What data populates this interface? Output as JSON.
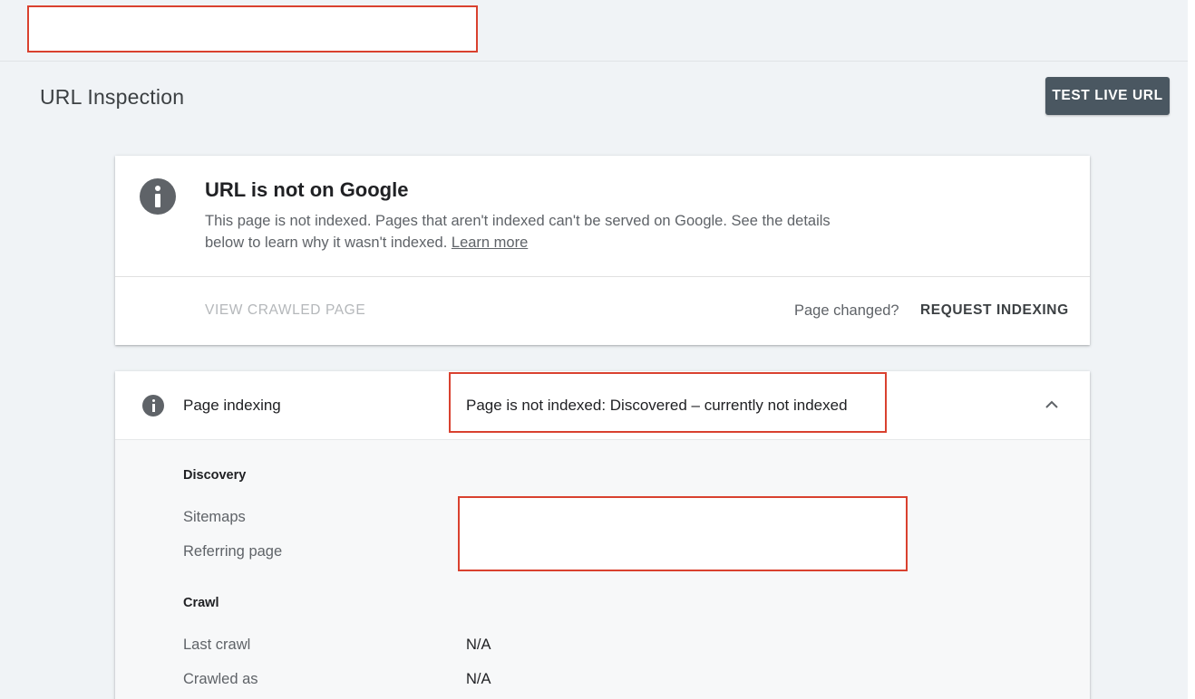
{
  "header": {
    "title": "URL Inspection",
    "test_live_url_label": "TEST LIVE URL"
  },
  "status_card": {
    "title": "URL is not on Google",
    "description": "This page is not indexed. Pages that aren't indexed can't be served on Google. See the details below to learn why it wasn't indexed.",
    "learn_more_label": "Learn more",
    "view_crawled_label": "VIEW CRAWLED PAGE",
    "page_changed_label": "Page changed?",
    "request_indexing_label": "REQUEST INDEXING",
    "icon": "info-icon"
  },
  "indexing_card": {
    "label": "Page indexing",
    "status": "Page is not indexed: Discovered – currently not indexed",
    "icon": "info-icon",
    "expanded": true,
    "sections": {
      "discovery": {
        "title": "Discovery",
        "rows": [
          {
            "label": "Sitemaps",
            "value": ""
          },
          {
            "label": "Referring page",
            "value": ""
          }
        ]
      },
      "crawl": {
        "title": "Crawl",
        "rows": [
          {
            "label": "Last crawl",
            "value": "N/A"
          },
          {
            "label": "Crawled as",
            "value": "N/A"
          }
        ]
      }
    }
  },
  "colors": {
    "background": "#f0f3f6",
    "primary_button": "#4a5761",
    "annotation_red": "#d9412f",
    "icon_gray": "#5f6368"
  }
}
